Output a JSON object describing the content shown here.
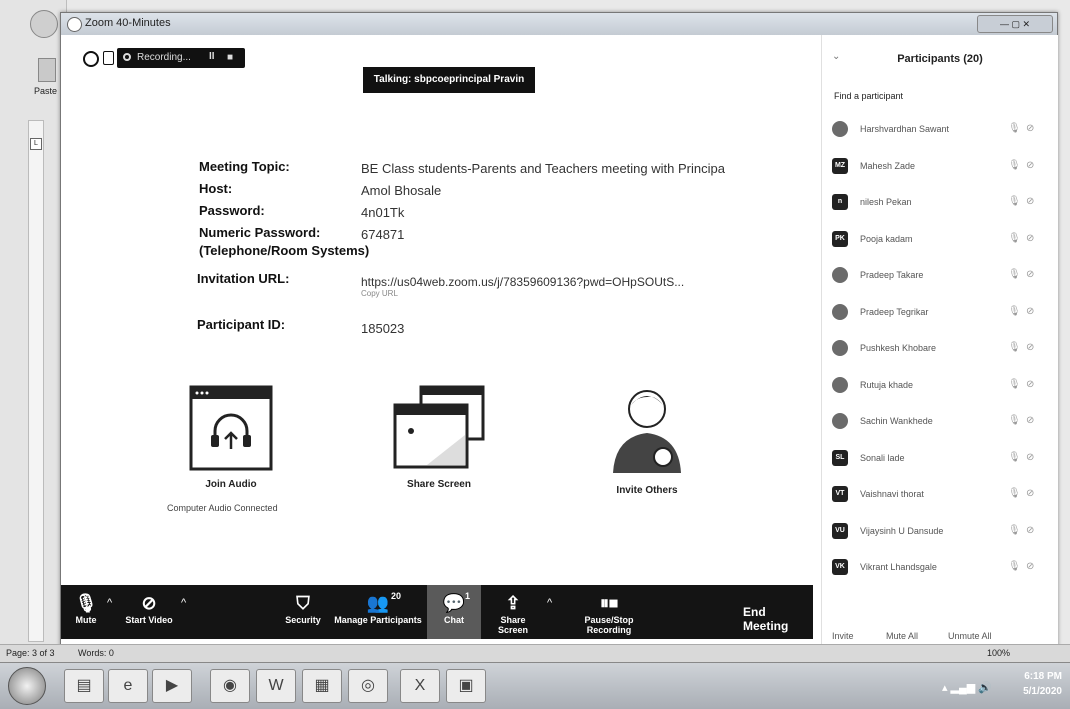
{
  "window": {
    "title": "Zoom 40-Minutes"
  },
  "recording": {
    "label": "Recording...",
    "pause_glyph": "II",
    "stop_glyph": "■"
  },
  "talking": {
    "text": "Talking: sbpcoeprincipal Pravin"
  },
  "meeting_info": {
    "topic_label": "Meeting Topic:",
    "topic_value": "BE Class students-Parents and Teachers meeting with Principa",
    "host_label": "Host:",
    "host_value": "Amol Bhosale",
    "password_label": "Password:",
    "password_value": "4n01Tk",
    "numeric_password_label": "Numeric Password:",
    "numeric_password_sub": "(Telephone/Room Systems)",
    "numeric_password_value": "674871",
    "invitation_label": "Invitation URL:",
    "invitation_value": "https://us04web.zoom.us/j/78359609136?pwd=OHpSOUtS...",
    "copy_url": "Copy URL",
    "participant_id_label": "Participant ID:",
    "participant_id_value": "185023"
  },
  "actions": {
    "join_audio": "Join Audio",
    "audio_status": "Computer Audio Connected",
    "share_screen": "Share Screen",
    "invite_others": "Invite Others"
  },
  "toolbar": {
    "mute": "Mute",
    "start_video": "Start Video",
    "security": "Security",
    "manage_participants": "Manage Participants",
    "participant_count": "20",
    "chat": "Chat",
    "chat_count": "1",
    "share_screen": "Share Screen",
    "pause_stop_recording": "Pause/Stop Recording",
    "end_meeting": "End Meeting"
  },
  "participants_panel": {
    "title": "Participants (20)",
    "find_placeholder": "Find a participant",
    "participants": [
      {
        "initials": "",
        "name": "Harshvardhan Sawant",
        "avatar": "photo"
      },
      {
        "initials": "MZ",
        "name": "Mahesh Zade",
        "avatar": "initials"
      },
      {
        "initials": "n",
        "name": "nilesh Pekan",
        "avatar": "initials"
      },
      {
        "initials": "PK",
        "name": "Pooja kadam",
        "avatar": "initials"
      },
      {
        "initials": "",
        "name": "Pradeep Takare",
        "avatar": "photo"
      },
      {
        "initials": "",
        "name": "Pradeep Tegrikar",
        "avatar": "photo"
      },
      {
        "initials": "",
        "name": "Pushkesh Khobare",
        "avatar": "photo"
      },
      {
        "initials": "",
        "name": "Rutuja khade",
        "avatar": "photo"
      },
      {
        "initials": "",
        "name": "Sachin Wankhede",
        "avatar": "photo"
      },
      {
        "initials": "SL",
        "name": "Sonali lade",
        "avatar": "initials"
      },
      {
        "initials": "VT",
        "name": "Vaishnavi thorat",
        "avatar": "initials"
      },
      {
        "initials": "VU",
        "name": "Vijaysinh U Dansude",
        "avatar": "initials"
      },
      {
        "initials": "VK",
        "name": "Vikrant Lhandsgale",
        "avatar": "initials"
      }
    ],
    "footer": {
      "invite": "Invite",
      "mute_all": "Mute All",
      "unmute_all": "Unmute All"
    }
  },
  "word": {
    "paste_label": "Paste",
    "page_status": "Page: 3 of 3",
    "words_status": "Words: 0",
    "zoom_status": "100%"
  },
  "taskbar": {
    "time": "6:18 PM",
    "date": "5/1/2020"
  }
}
